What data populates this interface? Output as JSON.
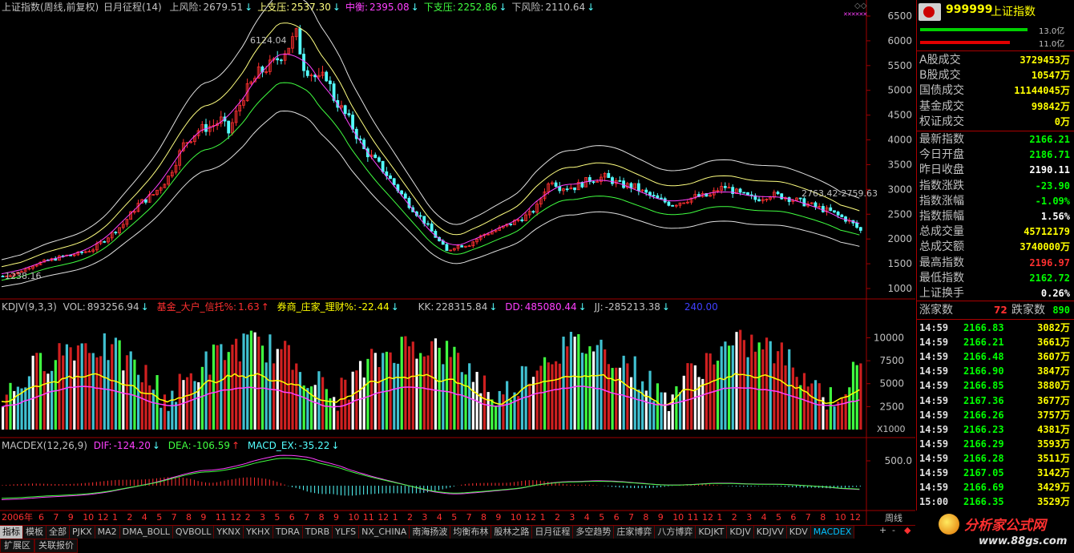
{
  "top_header": {
    "title": "上证指数(周线,前复权)",
    "indicator": "日月征程(14)",
    "items": [
      {
        "label": "上风险:",
        "value": "2679.51",
        "color": "#c0c0c0"
      },
      {
        "label": "上支压:",
        "value": "2537.30",
        "color": "#ffff80"
      },
      {
        "label": "中衡:",
        "value": "2395.08",
        "color": "#ff40ff"
      },
      {
        "label": "下支压:",
        "value": "2252.86",
        "color": "#40ff40"
      },
      {
        "label": "下风险:",
        "value": "2110.64",
        "color": "#c0c0c0"
      }
    ]
  },
  "kdj_header": {
    "name": "KDJV(9,3,3)",
    "vol_label": "VOL:",
    "vol_value": "893256.94",
    "fund_label": "基金_大户_信托%:",
    "fund_value": "1.63",
    "broker_label": "券商_庄家_理财%:",
    "broker_value": "-22.44",
    "kk_label": "KK:",
    "kk_value": "228315.84",
    "dd_label": "DD:",
    "dd_value": "485080.44",
    "jj_label": "JJ:",
    "jj_value": "-285213.38",
    "extra": "240.00"
  },
  "macd_header": {
    "name": "MACDEX(12,26,9)",
    "dif_label": "DIF:",
    "dif_value": "-124.20",
    "dea_label": "DEA:",
    "dea_value": "-106.59",
    "ex_label": "MACD_EX:",
    "ex_value": "-35.22"
  },
  "price_axis": [
    "6500",
    "6000",
    "5500",
    "5000",
    "4500",
    "4000",
    "3500",
    "3000",
    "2500",
    "2000",
    "1500",
    "1000"
  ],
  "vol_axis": [
    "10000",
    "7500",
    "5000",
    "2500"
  ],
  "vol_unit": "X1000",
  "macd_axis": [
    "500.0"
  ],
  "annotations": {
    "high": "6124.04",
    "low": "1238.16",
    "right": "2763.42-2759.63"
  },
  "x_axis": {
    "year": "2006年",
    "months": [
      "6",
      "7",
      "9",
      "10",
      "12",
      "1",
      "2",
      "4",
      "5",
      "7",
      "8",
      "9",
      "11",
      "12",
      "2",
      "3",
      "5",
      "6",
      "7",
      "8",
      "9",
      "10",
      "11",
      "12",
      "1",
      "2",
      "3",
      "4",
      "5",
      "7",
      "8",
      "9",
      "10",
      "12",
      "1",
      "2",
      "3",
      "4",
      "5",
      "6",
      "7",
      "8",
      "9",
      "10",
      "11",
      "12",
      "1",
      "2",
      "3",
      "4",
      "5",
      "6",
      "7",
      "8",
      "10",
      "12"
    ]
  },
  "period_label": "周线",
  "tabs": [
    "指标",
    "模板",
    "全部",
    "PJKX",
    "MA2",
    "DMA_BOLL",
    "QVBOLL",
    "YKNX",
    "YKHX",
    "TDRA",
    "TDRB",
    "YLFS",
    "NX_CHINA",
    "南海扬波",
    "均衡布林",
    "股林之路",
    "日月征程",
    "多空趋势",
    "庄家博弈",
    "八方博弈",
    "KDJKT",
    "KDJV",
    "KDJVV",
    "KDV",
    "MACDEX"
  ],
  "tabs2": [
    "扩展区",
    "关联报价"
  ],
  "nav_buttons": [
    "+",
    "-",
    "◆"
  ],
  "panel": {
    "code": "999999",
    "name": "上证指数",
    "bar1_label": "13.0亿",
    "bar2_label": "11.0亿",
    "stats1": [
      {
        "label": "A股成交",
        "value": "3729453万"
      },
      {
        "label": "B股成交",
        "value": "10547万"
      },
      {
        "label": "国债成交",
        "value": "11144045万"
      },
      {
        "label": "基金成交",
        "value": "99842万"
      },
      {
        "label": "权证成交",
        "value": "0万"
      }
    ],
    "stats2": [
      {
        "label": "最新指数",
        "value": "2166.21",
        "color": "#00ff00"
      },
      {
        "label": "今日开盘",
        "value": "2186.71",
        "color": "#00ff00"
      },
      {
        "label": "昨日收盘",
        "value": "2190.11",
        "color": "#ffffff"
      },
      {
        "label": "指数涨跌",
        "value": "-23.90",
        "color": "#00ff00"
      },
      {
        "label": "指数涨幅",
        "value": "-1.09%",
        "color": "#00ff00"
      },
      {
        "label": "指数振幅",
        "value": "1.56%",
        "color": "#ffffff"
      },
      {
        "label": "总成交量",
        "value": "45712179",
        "color": "#ffff00"
      },
      {
        "label": "总成交额",
        "value": "3740000万",
        "color": "#ffff00"
      },
      {
        "label": "最高指数",
        "value": "2196.97",
        "color": "#ff3030"
      },
      {
        "label": "最低指数",
        "value": "2162.72",
        "color": "#00ff00"
      },
      {
        "label": "上证换手",
        "value": "0.26%",
        "color": "#ffffff"
      }
    ],
    "up_label": "涨家数",
    "up_value": "72",
    "down_label": "跌家数",
    "down_value": "890",
    "ticks": [
      {
        "time": "14:59",
        "price": "2166.83",
        "vol": "3082万"
      },
      {
        "time": "14:59",
        "price": "2166.21",
        "vol": "3661万"
      },
      {
        "time": "14:59",
        "price": "2166.48",
        "vol": "3607万"
      },
      {
        "time": "14:59",
        "price": "2166.90",
        "vol": "3847万"
      },
      {
        "time": "14:59",
        "price": "2166.85",
        "vol": "3880万"
      },
      {
        "time": "14:59",
        "price": "2167.36",
        "vol": "3677万"
      },
      {
        "time": "14:59",
        "price": "2166.26",
        "vol": "3757万"
      },
      {
        "time": "14:59",
        "price": "2166.23",
        "vol": "4381万"
      },
      {
        "time": "14:59",
        "price": "2166.29",
        "vol": "3593万"
      },
      {
        "time": "14:59",
        "price": "2166.28",
        "vol": "3511万"
      },
      {
        "time": "14:59",
        "price": "2167.05",
        "vol": "3142万"
      },
      {
        "time": "14:59",
        "price": "2166.69",
        "vol": "3429万"
      },
      {
        "time": "15:00",
        "price": "2166.35",
        "vol": "3529万"
      }
    ],
    "logo_text": "分析家公式网",
    "logo_url": "www.88gs.com"
  },
  "colors": {
    "up": "#ff3030",
    "down": "#54ffff",
    "grid": "#800000",
    "axis_text": "#c0c0c0"
  },
  "chart_data": {
    "type": "candlestick",
    "title": "上证指数(周线,前复权)",
    "approx_weekly_close": [
      [
        0,
        1250
      ],
      [
        4,
        1320
      ],
      [
        8,
        1480
      ],
      [
        12,
        1560
      ],
      [
        16,
        1650
      ],
      [
        20,
        1700
      ],
      [
        24,
        1800
      ],
      [
        28,
        2050
      ],
      [
        32,
        2300
      ],
      [
        36,
        2700
      ],
      [
        40,
        2900
      ],
      [
        44,
        3250
      ],
      [
        48,
        3900
      ],
      [
        52,
        4200
      ],
      [
        56,
        4300
      ],
      [
        58,
        4400
      ],
      [
        60,
        4150
      ],
      [
        64,
        4900
      ],
      [
        68,
        5350
      ],
      [
        72,
        5550
      ],
      [
        76,
        5900
      ],
      [
        78,
        6124
      ],
      [
        80,
        5500
      ],
      [
        84,
        5200
      ],
      [
        86,
        5300
      ],
      [
        88,
        4850
      ],
      [
        92,
        4400
      ],
      [
        96,
        3800
      ],
      [
        100,
        3500
      ],
      [
        104,
        3100
      ],
      [
        108,
        2700
      ],
      [
        112,
        2350
      ],
      [
        116,
        1950
      ],
      [
        118,
        1750
      ],
      [
        120,
        1850
      ],
      [
        124,
        1900
      ],
      [
        128,
        2100
      ],
      [
        132,
        2200
      ],
      [
        136,
        2350
      ],
      [
        140,
        2500
      ],
      [
        142,
        2650
      ],
      [
        144,
        3000
      ],
      [
        146,
        3200
      ],
      [
        148,
        3050
      ],
      [
        152,
        3050
      ],
      [
        156,
        3200
      ],
      [
        160,
        3250
      ],
      [
        164,
        3100
      ],
      [
        168,
        3050
      ],
      [
        170,
        2950
      ],
      [
        174,
        2800
      ],
      [
        178,
        2700
      ],
      [
        180,
        2750
      ],
      [
        184,
        2850
      ],
      [
        188,
        2870
      ],
      [
        190,
        3000
      ],
      [
        192,
        3050
      ],
      [
        196,
        2900
      ],
      [
        200,
        2800
      ],
      [
        204,
        2900
      ],
      [
        208,
        2850
      ],
      [
        212,
        2750
      ],
      [
        216,
        2650
      ],
      [
        220,
        2550
      ],
      [
        224,
        2400
      ],
      [
        226,
        2300
      ],
      [
        228,
        2166
      ]
    ],
    "vol_axis_unit": "X1000"
  }
}
